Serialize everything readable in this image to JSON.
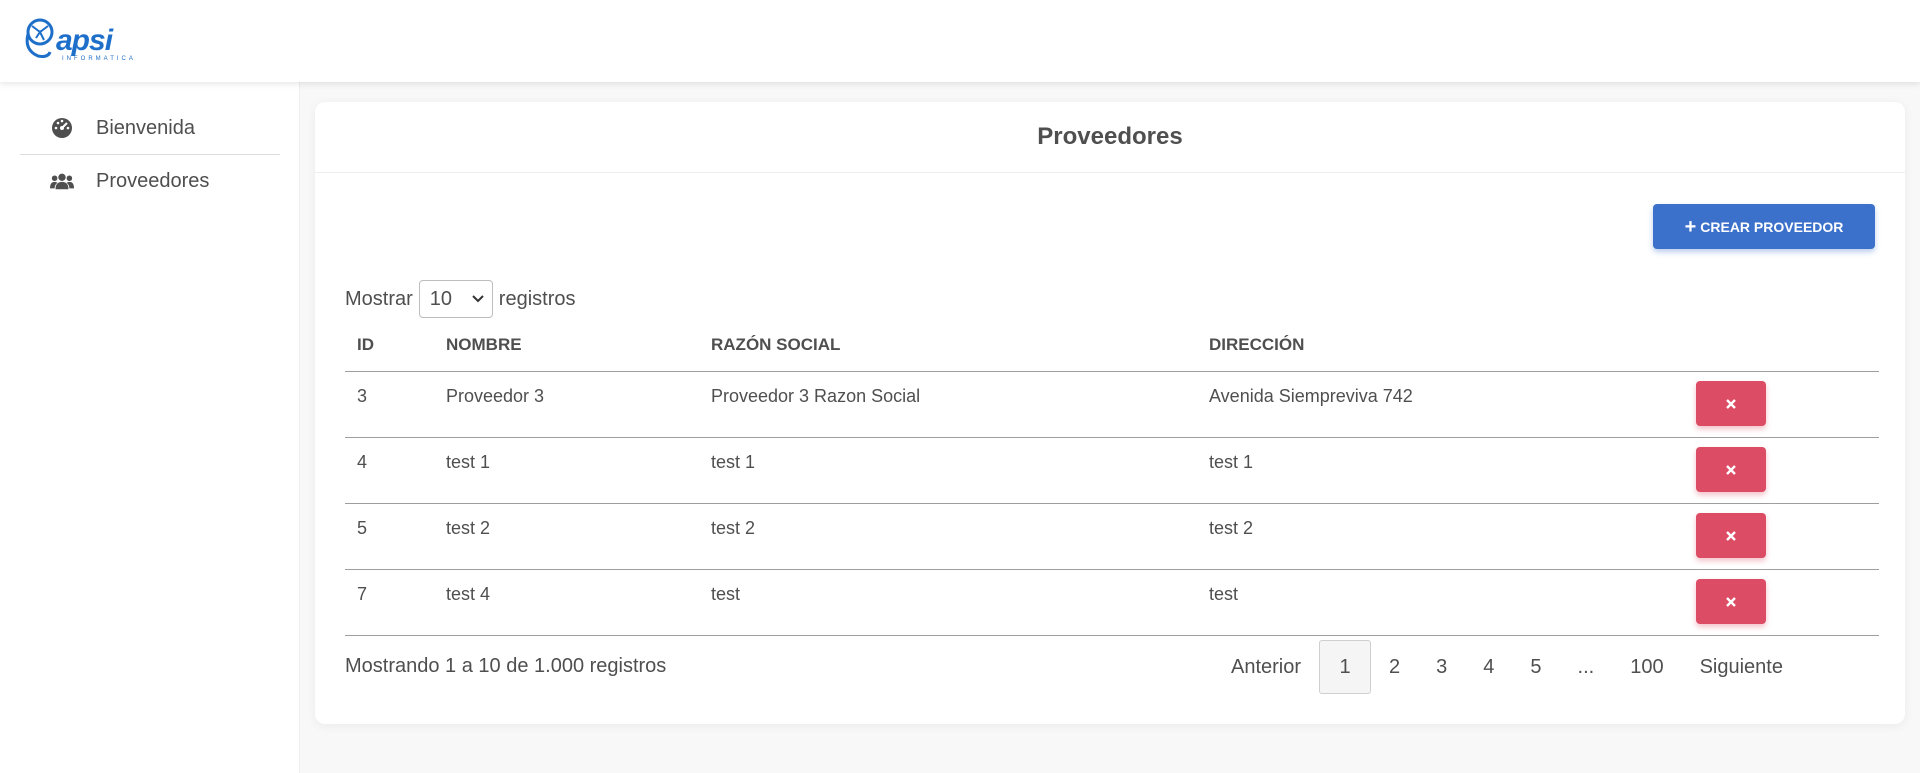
{
  "brand": {
    "logo_text": "apsi",
    "logo_sub": "INFORMATICA",
    "accent": "#1e6fc9"
  },
  "sidebar": {
    "items": [
      {
        "label": "Bienvenida",
        "icon": "dashboard-gauge-icon"
      },
      {
        "label": "Proveedores",
        "icon": "users-group-icon"
      }
    ]
  },
  "main": {
    "title": "Proveedores",
    "create_button": {
      "label": "CREAR PROVEEDOR",
      "icon": "plus-icon",
      "color": "#3b71ca"
    },
    "entries": {
      "prefix": "Mostrar",
      "value": "10",
      "suffix": "registros"
    },
    "table": {
      "headers": [
        "ID",
        "NOMBRE",
        "RAZÓN SOCIAL",
        "DIRECCIÓN"
      ],
      "rows": [
        {
          "id": "3",
          "nombre": "Proveedor 3",
          "razon": "Proveedor 3 Razon Social",
          "direccion": "Avenida Siempreviva 742"
        },
        {
          "id": "4",
          "nombre": "test 1",
          "razon": "test 1",
          "direccion": "test 1"
        },
        {
          "id": "5",
          "nombre": "test 2",
          "razon": "test 2",
          "direccion": "test 2"
        },
        {
          "id": "7",
          "nombre": "test 4",
          "razon": "test",
          "direccion": "test"
        }
      ],
      "delete_icon": "close-icon",
      "delete_color": "#dc4c64"
    },
    "footer_info": "Mostrando 1 a 10 de 1.000 registros",
    "pagination": {
      "prev": "Anterior",
      "pages": [
        "1",
        "2",
        "3",
        "4",
        "5",
        "...",
        "100"
      ],
      "active": "1",
      "next": "Siguiente"
    }
  }
}
